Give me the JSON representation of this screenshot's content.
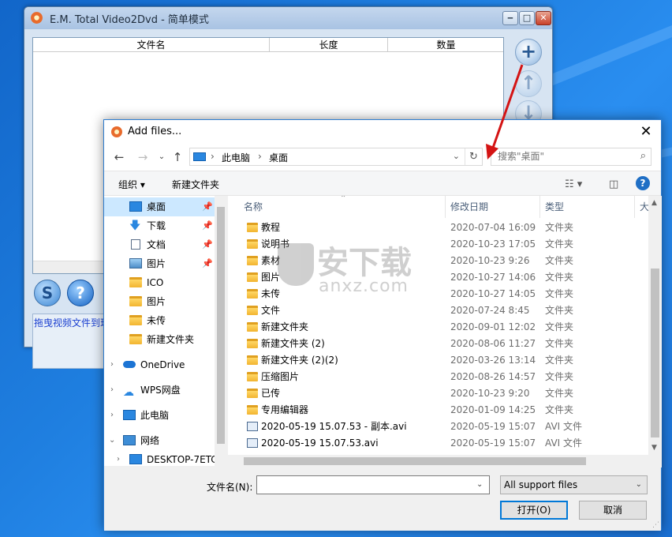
{
  "app": {
    "title": "E.M. Total Video2Dvd - 简单模式",
    "columns": [
      "文件名",
      "长度",
      "数量"
    ],
    "drag_hint": "拖曳视频文件到现"
  },
  "dialog": {
    "title": "Add files...",
    "breadcrumb": [
      "此电脑",
      "桌面"
    ],
    "search_placeholder": "搜索\"桌面\"",
    "toolbar": {
      "organize": "组织 ▾",
      "new_folder": "新建文件夹"
    },
    "nav_items": [
      {
        "label": "桌面",
        "icon": "desktop-icon",
        "pinned": true,
        "selected": true
      },
      {
        "label": "下载",
        "icon": "download-icon",
        "pinned": true
      },
      {
        "label": "文档",
        "icon": "document-icon",
        "pinned": true
      },
      {
        "label": "图片",
        "icon": "picture-icon",
        "pinned": true
      },
      {
        "label": "ICO",
        "icon": "folder-icon"
      },
      {
        "label": "图片",
        "icon": "folder-icon"
      },
      {
        "label": "未传",
        "icon": "folder-icon"
      },
      {
        "label": "新建文件夹",
        "icon": "folder-icon"
      },
      {
        "label": "OneDrive",
        "icon": "onedrive-icon",
        "expandable": true
      },
      {
        "label": "WPS网盘",
        "icon": "cloud-icon",
        "expandable": true
      },
      {
        "label": "此电脑",
        "icon": "computer-icon",
        "expandable": true
      },
      {
        "label": "网络",
        "icon": "network-icon",
        "expanded": true
      },
      {
        "label": "DESKTOP-7ETC",
        "icon": "computer-icon",
        "expandable": true
      }
    ],
    "file_columns": [
      "名称",
      "修改日期",
      "类型",
      "大"
    ],
    "files": [
      {
        "name": "教程",
        "date": "2020-07-04 16:09",
        "type": "文件夹",
        "kind": "folder"
      },
      {
        "name": "说明书",
        "date": "2020-10-23 17:05",
        "type": "文件夹",
        "kind": "folder"
      },
      {
        "name": "素材",
        "date": "2020-10-23 9:26",
        "type": "文件夹",
        "kind": "folder"
      },
      {
        "name": "图片",
        "date": "2020-10-27 14:06",
        "type": "文件夹",
        "kind": "folder"
      },
      {
        "name": "未传",
        "date": "2020-10-27 14:05",
        "type": "文件夹",
        "kind": "folder"
      },
      {
        "name": "文件",
        "date": "2020-07-24 8:45",
        "type": "文件夹",
        "kind": "folder"
      },
      {
        "name": "新建文件夹",
        "date": "2020-09-01 12:02",
        "type": "文件夹",
        "kind": "folder"
      },
      {
        "name": "新建文件夹 (2)",
        "date": "2020-08-06 11:27",
        "type": "文件夹",
        "kind": "folder"
      },
      {
        "name": "新建文件夹 (2)(2)",
        "date": "2020-03-26 13:14",
        "type": "文件夹",
        "kind": "folder"
      },
      {
        "name": "压缩图片",
        "date": "2020-08-26 14:57",
        "type": "文件夹",
        "kind": "folder"
      },
      {
        "name": "已传",
        "date": "2020-10-23 9:20",
        "type": "文件夹",
        "kind": "folder"
      },
      {
        "name": "专用编辑器",
        "date": "2020-01-09 14:25",
        "type": "文件夹",
        "kind": "folder"
      },
      {
        "name": "2020-05-19 15.07.53 - 副本.avi",
        "date": "2020-05-19 15:07",
        "type": "AVI 文件",
        "kind": "avi"
      },
      {
        "name": "2020-05-19 15.07.53.avi",
        "date": "2020-05-19 15:07",
        "type": "AVI 文件",
        "kind": "avi"
      }
    ],
    "filename_label": "文件名(N):",
    "filename_value": "",
    "filter_value": "All support files",
    "open_label": "打开(O)",
    "cancel_label": "取消"
  },
  "watermark": {
    "big": "安下载",
    "small": "anxz.com"
  },
  "colors": {
    "accent": "#0078d7",
    "arrow": "#d41414",
    "selected_bg": "#cce8ff"
  }
}
